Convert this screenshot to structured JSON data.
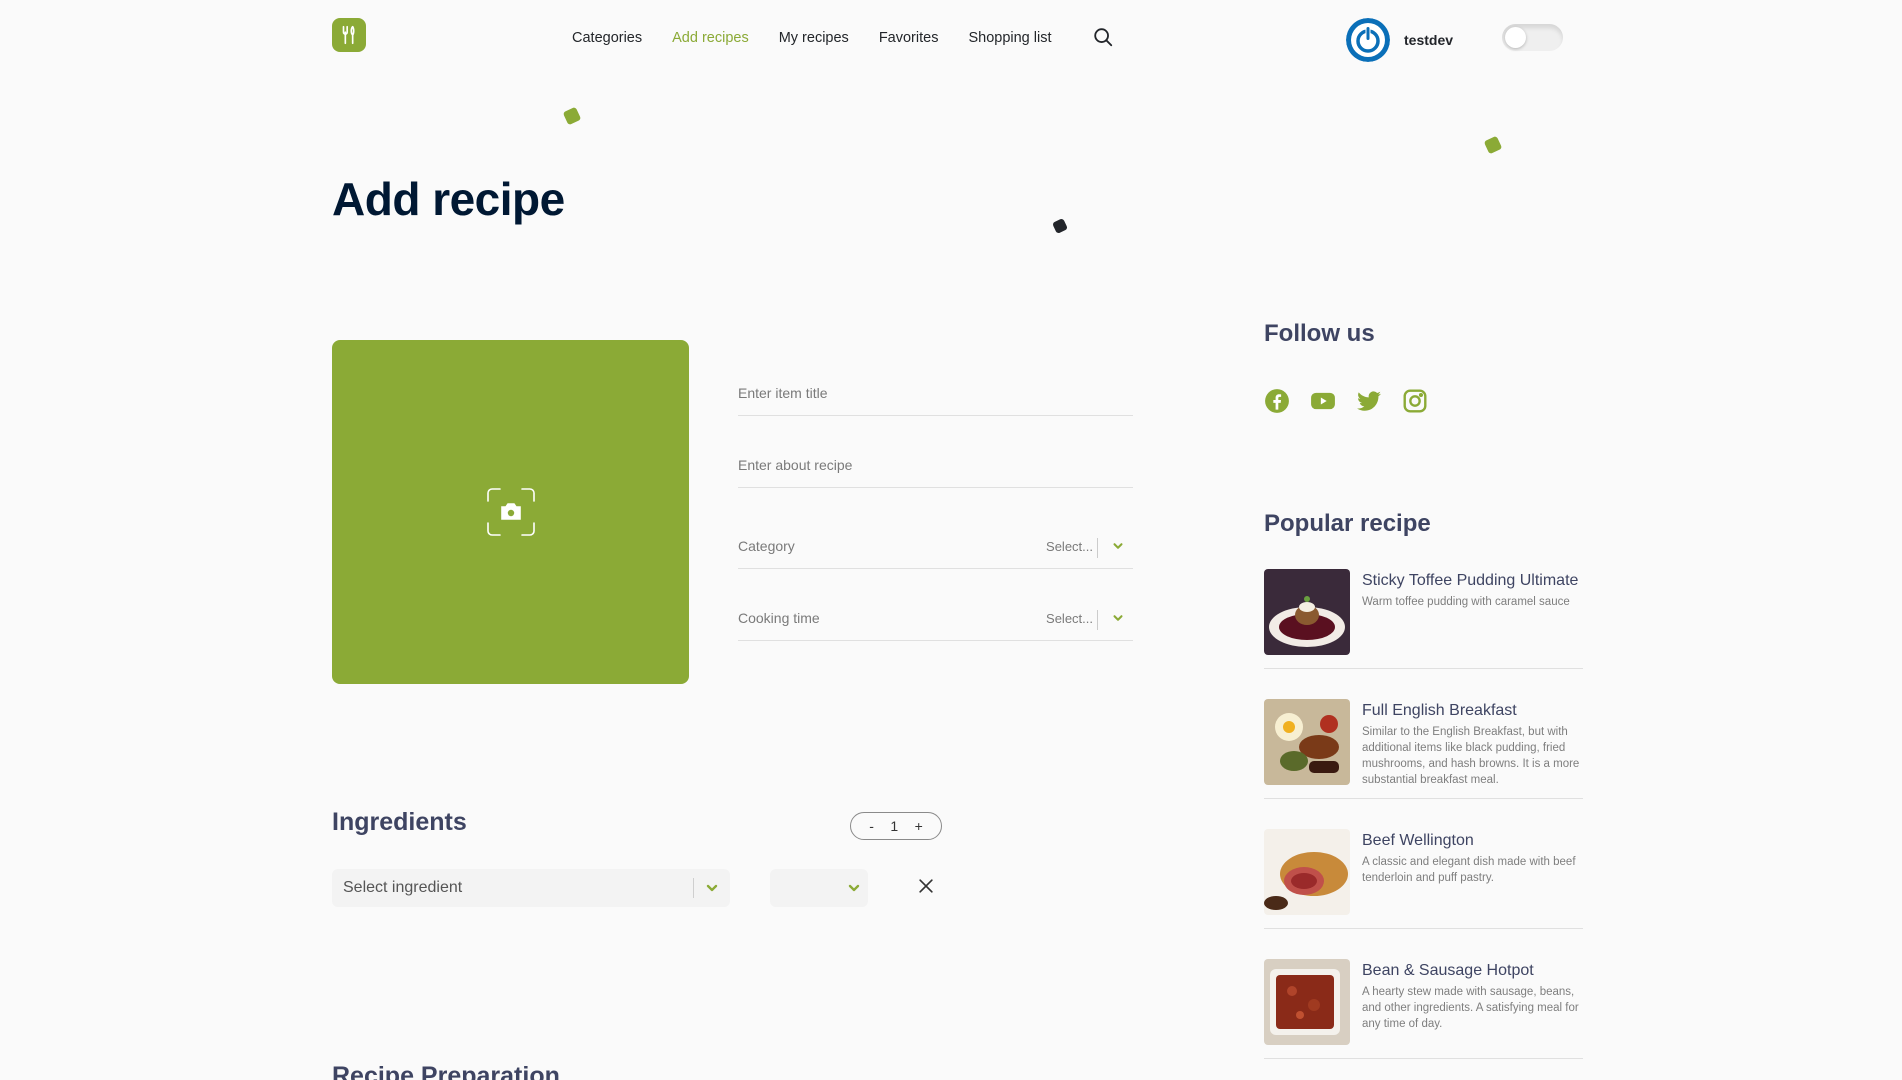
{
  "header": {
    "nav": [
      "Categories",
      "Add recipes",
      "My recipes",
      "Favorites",
      "Shopping list"
    ],
    "active_nav": "Add recipes",
    "username": "testdev",
    "logo_icon": "fork-knife-icon",
    "search_icon": "search-icon",
    "theme_toggle_on": false
  },
  "page": {
    "title": "Add recipe"
  },
  "form": {
    "title_placeholder": "Enter item title",
    "about_placeholder": "Enter about recipe",
    "category_label": "Category",
    "category_value": "Select...",
    "time_label": "Cooking time",
    "time_value": "Select...",
    "upload_icon": "camera-icon"
  },
  "sidebar": {
    "follow_title": "Follow us",
    "socials": [
      "facebook-icon",
      "youtube-icon",
      "twitter-icon",
      "instagram-icon"
    ],
    "popular_title": "Popular recipe",
    "popular": [
      {
        "title": "Sticky Toffee Pudding Ultimate",
        "desc": "Warm toffee pudding with caramel sauce"
      },
      {
        "title": "Full English Breakfast",
        "desc": "Similar to the English Breakfast, but with additional items like black pudding, fried mushrooms, and hash browns. It is a more substantial breakfast meal."
      },
      {
        "title": "Beef Wellington",
        "desc": "A classic and elegant dish made with beef tenderloin and puff pastry."
      },
      {
        "title": "Bean & Sausage Hotpot",
        "desc": "A hearty stew made with sausage, beans, and other ingredients. A satisfying meal for any time of day."
      }
    ]
  },
  "ingredients": {
    "title": "Ingredients",
    "count": "1",
    "minus": "-",
    "plus": "+",
    "select_placeholder": "Select ingredient"
  },
  "preparation": {
    "title": "Recipe Preparation"
  },
  "colors": {
    "accent": "#8baa36",
    "heading": "#001833",
    "subheading": "#3e4462"
  }
}
